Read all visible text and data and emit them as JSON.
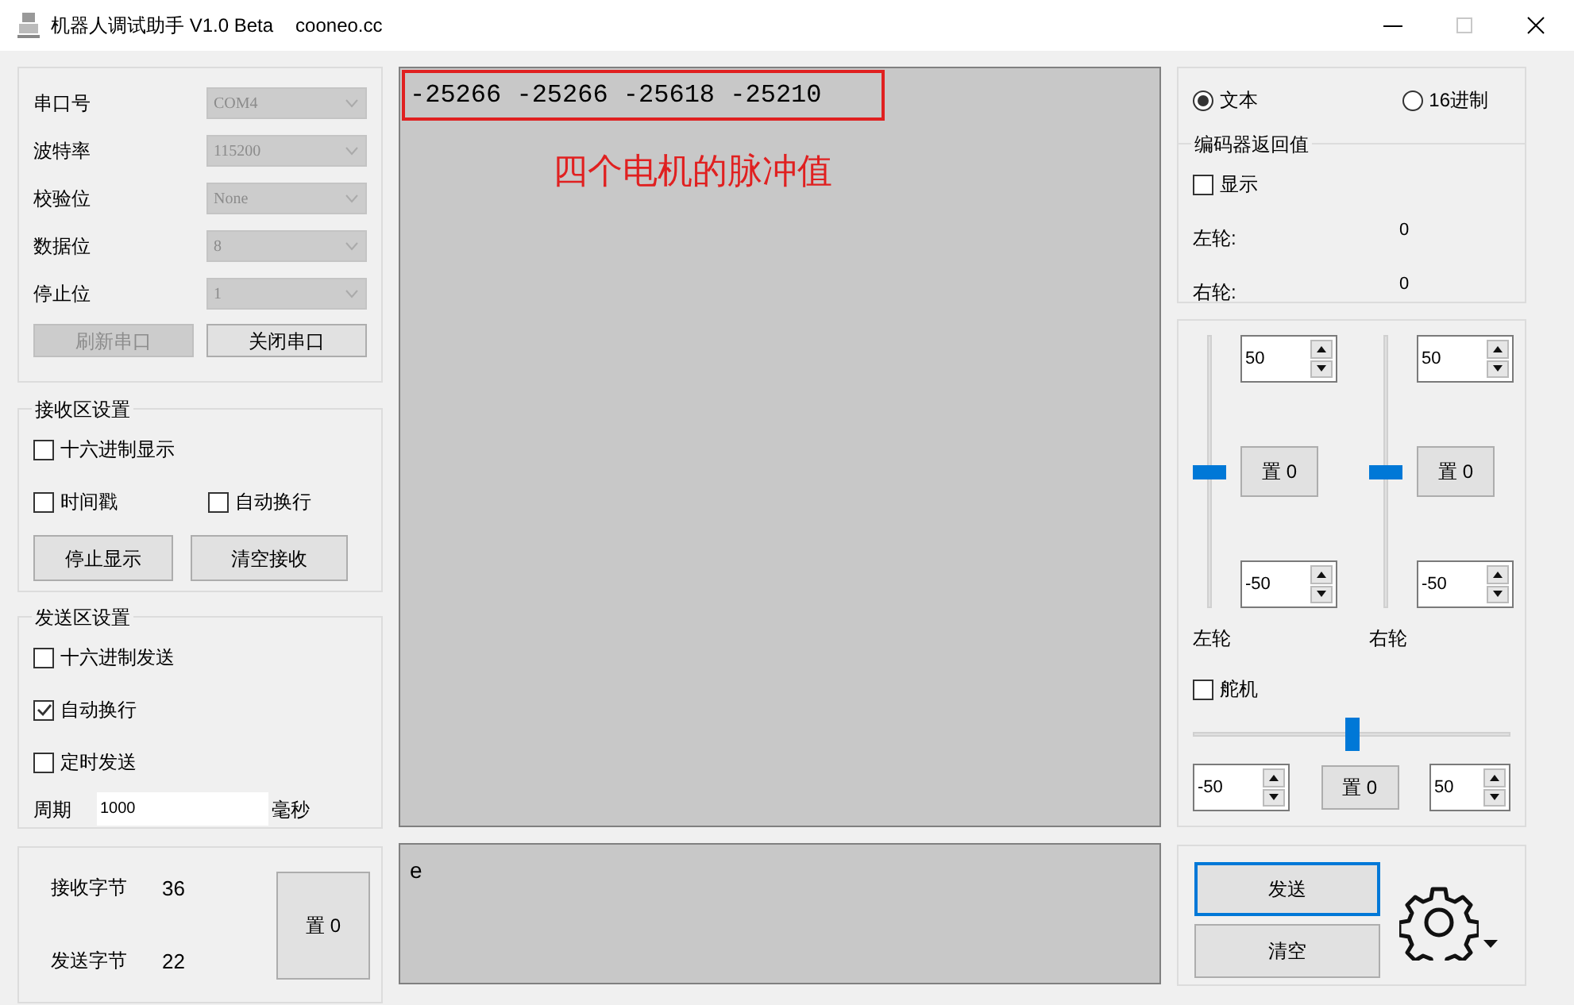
{
  "window": {
    "title": "机器人调试助手 V1.0 Beta",
    "site": "cooneo.cc",
    "maximize_disabled": true
  },
  "serial": {
    "fields": [
      {
        "label": "串口号",
        "value": "COM4",
        "disabled": true
      },
      {
        "label": "波特率",
        "value": "115200",
        "disabled": true
      },
      {
        "label": "校验位",
        "value": "None",
        "disabled": true
      },
      {
        "label": "数据位",
        "value": "8",
        "disabled": true
      },
      {
        "label": "停止位",
        "value": "1",
        "disabled": true
      }
    ],
    "buttons": [
      {
        "label": "刷新串口",
        "disabled": true
      },
      {
        "label": "关闭串口",
        "disabled": false
      }
    ]
  },
  "receive_settings": {
    "title": "接收区设置",
    "checkboxes": [
      {
        "label": "十六进制显示",
        "checked": false
      },
      {
        "label": "时间戳",
        "checked": false
      },
      {
        "label": "自动换行",
        "checked": false
      }
    ],
    "buttons": [
      "停止显示",
      "清空接收"
    ]
  },
  "send_settings": {
    "title": "发送区设置",
    "checkboxes": [
      {
        "label": "十六进制发送",
        "checked": false
      },
      {
        "label": "自动换行",
        "checked": true
      },
      {
        "label": "定时发送",
        "checked": false
      }
    ],
    "period_label": "周期",
    "period_value": "1000",
    "period_unit": "毫秒"
  },
  "counters": {
    "items": [
      {
        "label": "接收字节",
        "value": "36"
      },
      {
        "label": "发送字节",
        "value": "22"
      }
    ],
    "reset": "置 0"
  },
  "receive_area": {
    "text": "-25266 -25266 -25618 -25210",
    "annotation": "四个电机的脉冲值"
  },
  "send_area": {
    "text": "e"
  },
  "display_mode": [
    {
      "label": "文本",
      "selected": true
    },
    {
      "label": "16进制",
      "selected": false
    }
  ],
  "encoder": {
    "title": "编码器返回值",
    "show": {
      "label": "显示",
      "checked": false
    },
    "readings": [
      {
        "label": "左轮:",
        "value": "0"
      },
      {
        "label": "右轮:",
        "value": "0"
      }
    ]
  },
  "wheels": [
    {
      "label": "左轮",
      "level": 0.5,
      "max": "50",
      "reset": "置 0",
      "min": "-50"
    },
    {
      "label": "右轮",
      "level": 0.5,
      "max": "50",
      "reset": "置 0",
      "min": "-50"
    }
  ],
  "servo": {
    "label": "舵机",
    "checked": false,
    "level": 0.5,
    "min": "-50",
    "reset": "置 0",
    "max": "50"
  },
  "actions": [
    {
      "label": "发送",
      "focused": true
    },
    {
      "label": "清空",
      "focused": false
    }
  ]
}
